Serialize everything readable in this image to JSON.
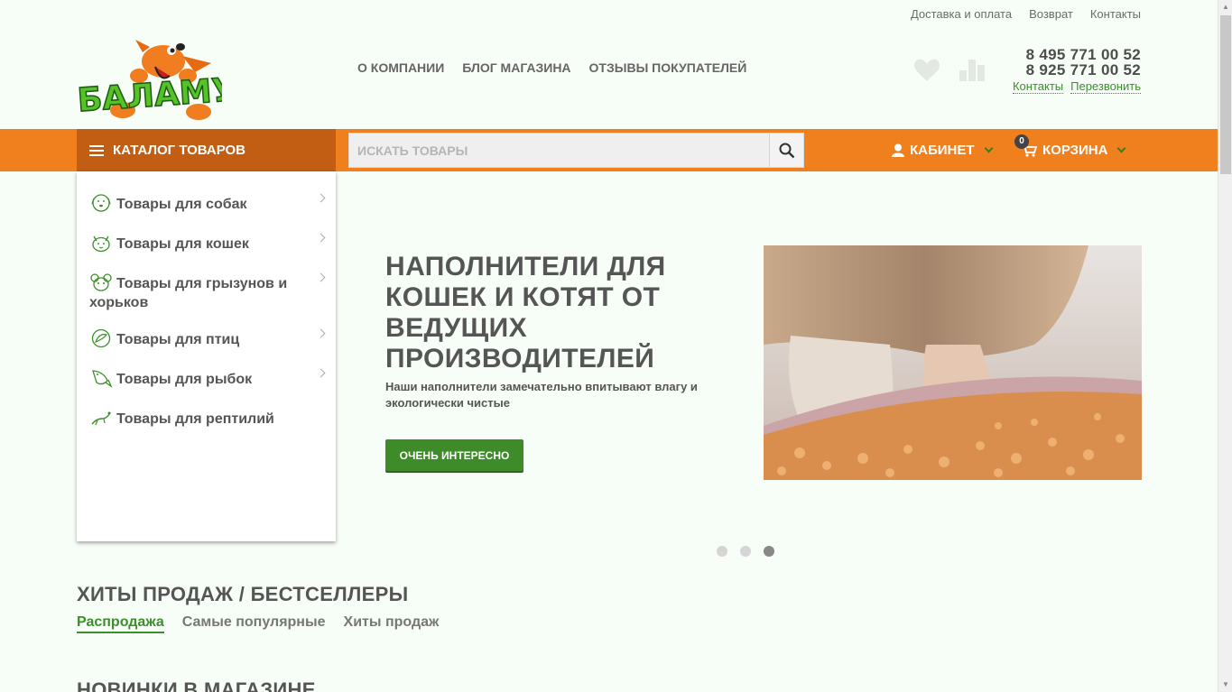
{
  "top_links": [
    "Доставка и оплата",
    "Возврат",
    "Контакты"
  ],
  "logo_text": "БАЛАМУТ",
  "main_nav": [
    "О КОМПАНИИ",
    "БЛОГ МАГАЗИНА",
    "ОТЗЫВЫ ПОКУПАТЕЛЕЙ"
  ],
  "phones": {
    "phone1": "8 495 771 00 52",
    "phone2": "8 925 771 00 52",
    "contacts_link": "Контакты",
    "callback_link": "Перезвонить"
  },
  "bar": {
    "catalog_label": "КАТАЛОГ ТОВАРОВ",
    "search_placeholder": "ИСКАТЬ ТОВАРЫ",
    "cabinet_label": "КАБИНЕТ",
    "cart_label": "КОРЗИНА",
    "cart_count": "0",
    "accent_color": "#f0801e",
    "catalog_bg": "#c15e14"
  },
  "catalog": [
    {
      "label": "Товары для собак",
      "icon": "dog-icon",
      "has_submenu": true
    },
    {
      "label": "Товары для кошек",
      "icon": "cat-icon",
      "has_submenu": true
    },
    {
      "label": "Товары для грызунов и хорьков",
      "icon": "rodent-icon",
      "has_submenu": true
    },
    {
      "label": "Товары для птиц",
      "icon": "bird-icon",
      "has_submenu": true
    },
    {
      "label": "Товары для рыбок",
      "icon": "fish-icon",
      "has_submenu": true
    },
    {
      "label": "Товары для рептилий",
      "icon": "lizard-icon",
      "has_submenu": false
    }
  ],
  "hero": {
    "title": "НАПОЛНИТЕЛИ ДЛЯ КОШЕК И КОТЯТ ОТ ВЕДУЩИХ ПРОИЗВОДИТЕЛЕЙ",
    "subtitle": "Наши наполнители замечательно впитывают влагу и экологически чистые",
    "button": "ОЧЕНЬ ИНТЕРЕСНО",
    "button_color": "#3d8c29",
    "slides_total": 3,
    "active_slide": 3
  },
  "bestsellers": {
    "title": "ХИТЫ ПРОДАЖ / БЕСТСЕЛЛЕРЫ",
    "tabs": [
      "Распродажа",
      "Самые популярные",
      "Хиты продаж"
    ],
    "active_tab": "Распродажа"
  },
  "new_items_title": "НОВИНКИ В МАГАЗИНЕ"
}
